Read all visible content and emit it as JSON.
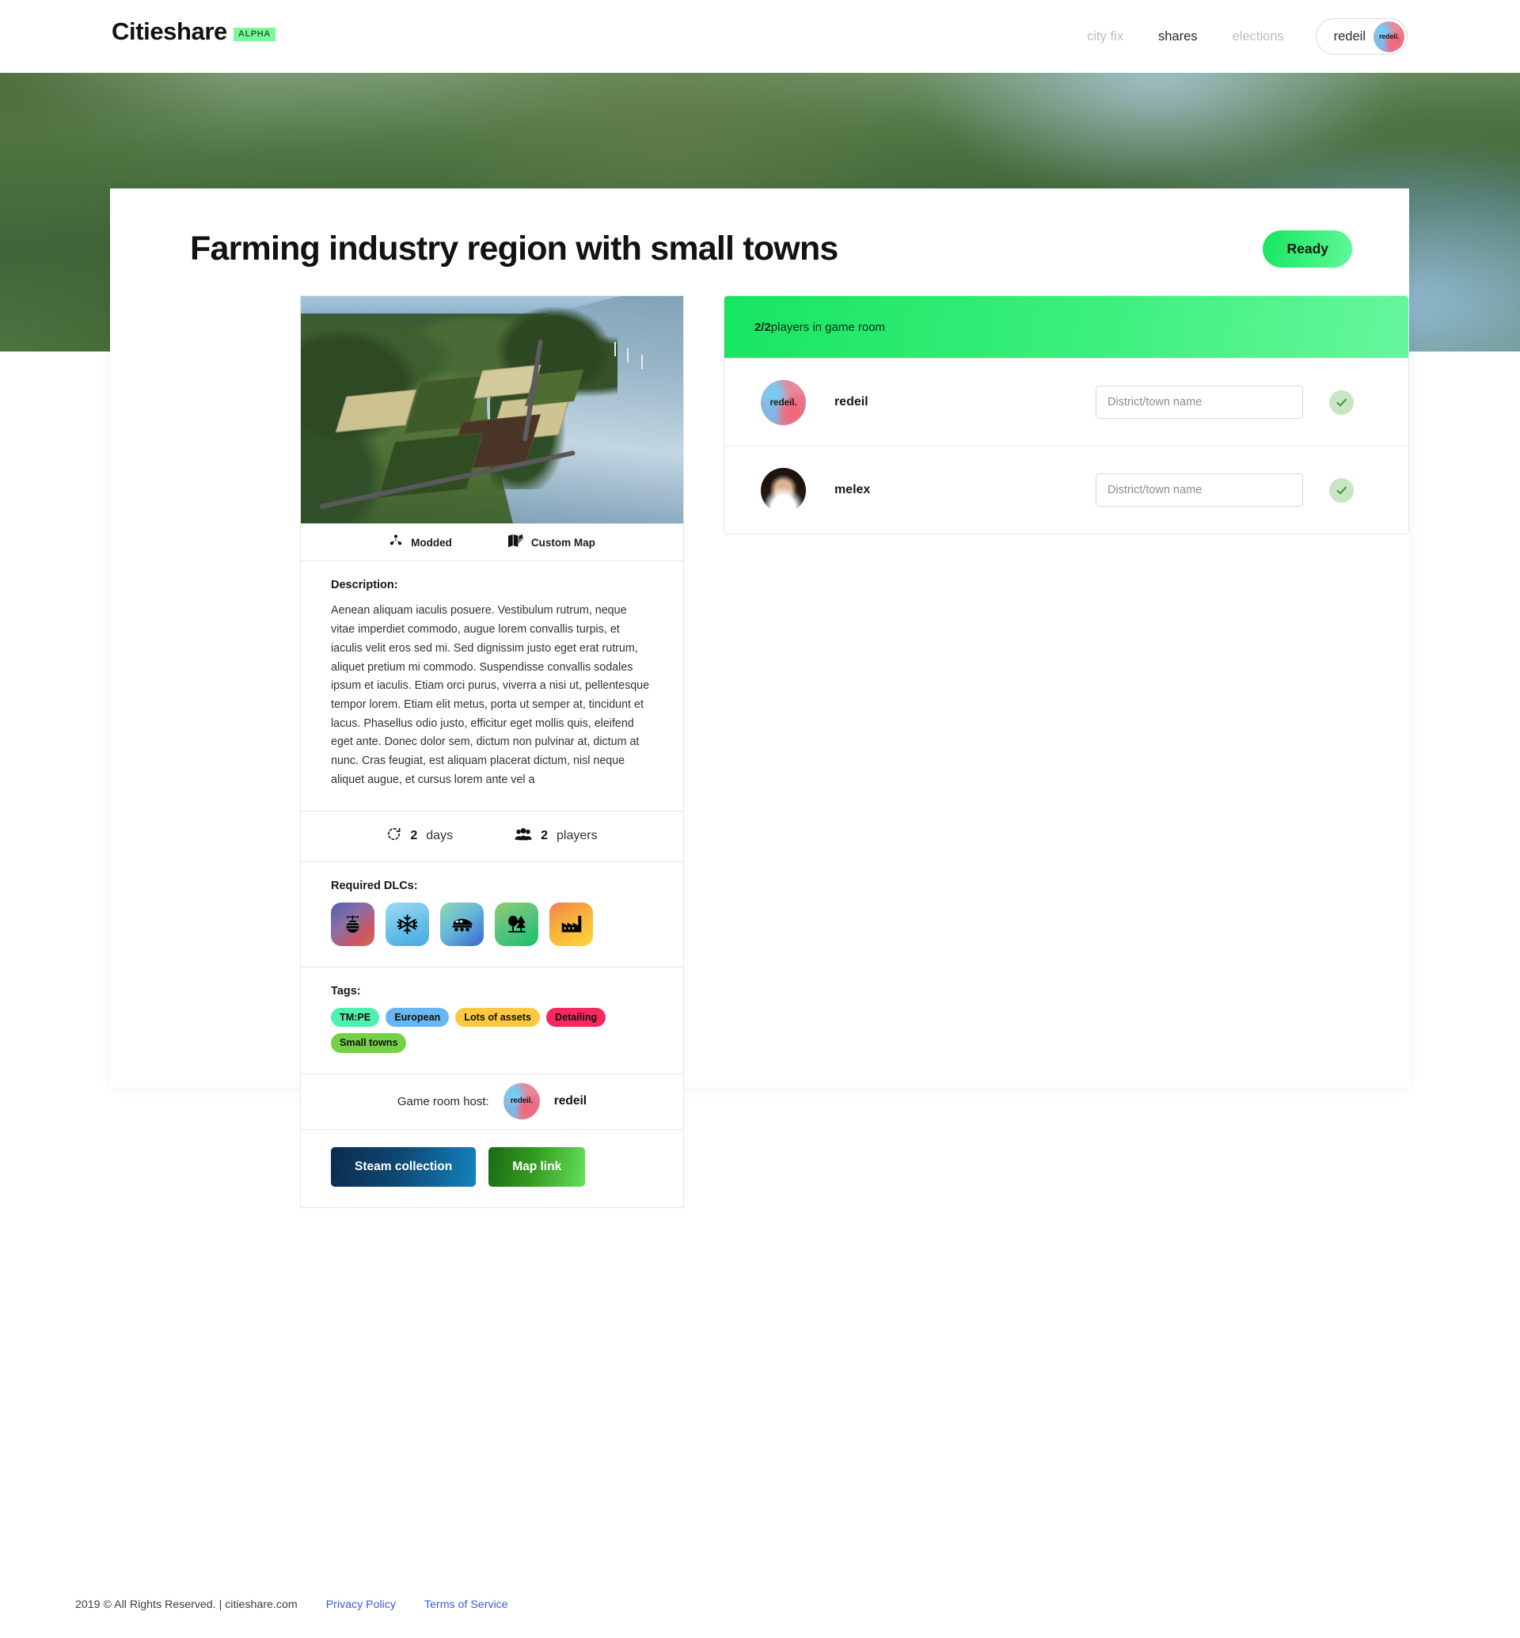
{
  "header": {
    "brand": "Citieshare",
    "alpha_badge": "ALPHA",
    "nav": [
      {
        "label": "city fix",
        "active": false
      },
      {
        "label": "shares",
        "active": true
      },
      {
        "label": "elections",
        "active": false
      }
    ],
    "user": {
      "name": "redeil",
      "avatar_label": "redeil."
    }
  },
  "page": {
    "title": "Farming industry region with small towns",
    "ready_label": "Ready"
  },
  "map_card": {
    "badges": [
      {
        "icon": "cubes-icon",
        "label": "Modded"
      },
      {
        "icon": "map-marked-icon",
        "label": "Custom Map"
      }
    ],
    "description_label": "Description:",
    "description": "Aenean aliquam iaculis posuere. Vestibulum rutrum, neque vitae imperdiet commodo, augue lorem convallis turpis, et iaculis velit eros sed mi. Sed dignissim justo eget erat rutrum, aliquet pretium mi commodo. Suspendisse convallis sodales ipsum et iaculis. Etiam orci purus, viverra a nisi ut, pellentesque tempor lorem. Etiam elit metus, porta ut semper at, tincidunt et lacus. Phasellus odio justo, efficitur eget mollis quis, eleifend eget ante. Donec dolor sem, dictum non pulvinar at, dictum at nunc. Cras feugiat, est aliquam placerat dictum, nisl neque aliquet augue, et cursus lorem ante vel a",
    "stats": [
      {
        "icon": "rotate-icon",
        "value": "2",
        "label": "days"
      },
      {
        "icon": "users-icon",
        "value": "2",
        "label": "players"
      }
    ],
    "dlc_label": "Required DLCs:",
    "dlcs": [
      {
        "icon": "disco-ball-icon",
        "name": "After Dark"
      },
      {
        "icon": "snowflake-icon",
        "name": "Snowfall"
      },
      {
        "icon": "train-icon",
        "name": "Mass Transit"
      },
      {
        "icon": "trees-icon",
        "name": "Green Cities"
      },
      {
        "icon": "factory-icon",
        "name": "Industries"
      }
    ],
    "tags_label": "Tags:",
    "tags": [
      {
        "label": "TM:PE",
        "color": "#4ef0b0"
      },
      {
        "label": "European",
        "color": "#68b6f2"
      },
      {
        "label": "Lots of assets",
        "color": "#fcc741"
      },
      {
        "label": "Detailing",
        "color": "#f6285f"
      },
      {
        "label": "Small towns",
        "color": "#74d046"
      }
    ],
    "host_label": "Game room host:",
    "host_name": "redeil",
    "host_avatar_label": "redeil.",
    "buttons": {
      "steam": "Steam collection",
      "map": "Map link"
    }
  },
  "game_room": {
    "count": "2/2",
    "count_suffix": " players in game room",
    "players": [
      {
        "name": "redeil",
        "avatar_label": "redeil.",
        "avatar_kind": "redeil",
        "town_placeholder": "District/town name",
        "town_value": "",
        "ready": true
      },
      {
        "name": "melex",
        "avatar_label": "",
        "avatar_kind": "melex",
        "town_placeholder": "District/town name",
        "town_value": "",
        "ready": true
      }
    ]
  },
  "footer": {
    "copyright": "2019 © All Rights Reserved. | citieshare.com",
    "privacy": "Privacy Policy",
    "terms": "Terms of Service"
  },
  "colors": {
    "accent_green": "#2ded6f",
    "link_blue": "#3c5adb",
    "alpha_badge_bg": "#7cf79a"
  }
}
